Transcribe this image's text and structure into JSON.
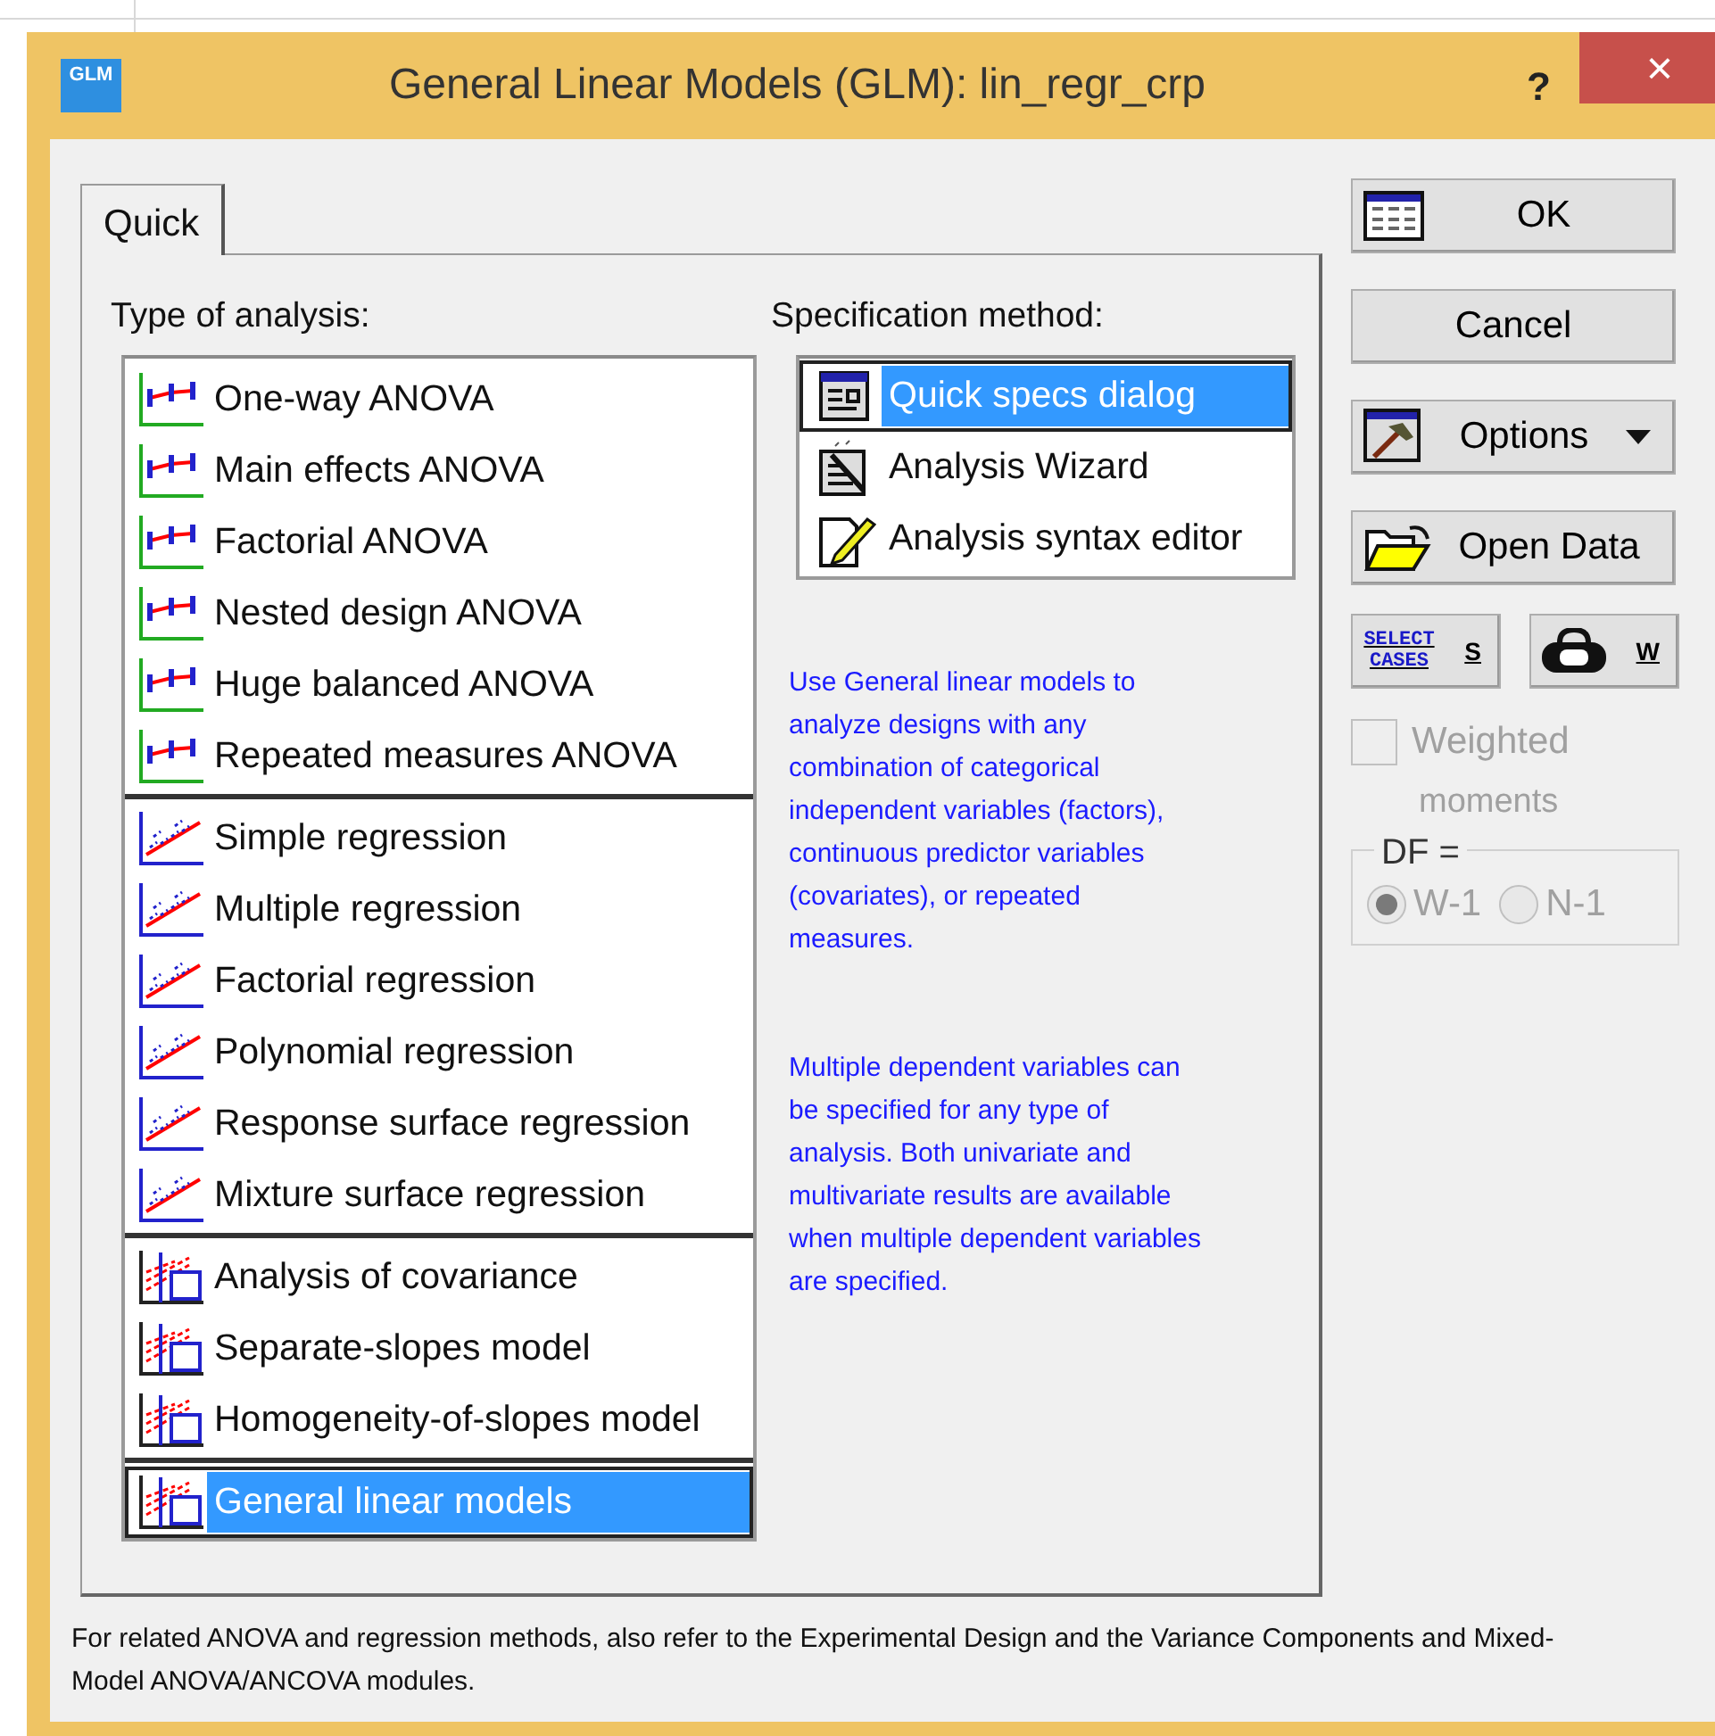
{
  "window": {
    "title": "General Linear Models (GLM): lin_regr_crp",
    "icon_text": "GLM",
    "help": "?",
    "close": "×"
  },
  "tabs": [
    {
      "label": "Quick",
      "selected": true
    }
  ],
  "analysis": {
    "label": "Type of analysis:",
    "groups": [
      {
        "items": [
          {
            "label": "One-way ANOVA",
            "selected": false
          },
          {
            "label": "Main effects ANOVA",
            "selected": false
          },
          {
            "label": "Factorial ANOVA",
            "selected": false
          },
          {
            "label": "Nested design ANOVA",
            "selected": false
          },
          {
            "label": "Huge balanced ANOVA",
            "selected": false
          },
          {
            "label": "Repeated measures ANOVA",
            "selected": false
          }
        ]
      },
      {
        "items": [
          {
            "label": "Simple regression",
            "selected": false
          },
          {
            "label": "Multiple regression",
            "selected": false
          },
          {
            "label": "Factorial regression",
            "selected": false
          },
          {
            "label": "Polynomial regression",
            "selected": false
          },
          {
            "label": "Response surface regression",
            "selected": false
          },
          {
            "label": "Mixture surface regression",
            "selected": false
          }
        ]
      },
      {
        "items": [
          {
            "label": "Analysis of covariance",
            "selected": false
          },
          {
            "label": "Separate-slopes model",
            "selected": false
          },
          {
            "label": "Homogeneity-of-slopes model",
            "selected": false
          }
        ]
      },
      {
        "items": [
          {
            "label": "General linear models",
            "selected": true
          }
        ]
      }
    ]
  },
  "specification": {
    "label": "Specification method:",
    "items": [
      {
        "label": "Quick specs dialog",
        "selected": true
      },
      {
        "label": "Analysis Wizard",
        "selected": false
      },
      {
        "label": "Analysis syntax editor",
        "selected": false
      }
    ]
  },
  "notes": [
    "Use General linear models to analyze designs with any combination of categorical independent variables (factors), continuous predictor variables (covariates), or repeated measures.",
    "Multiple dependent variables can be specified for any type of analysis.  Both univariate and multivariate results are available when multiple dependent variables are specified."
  ],
  "buttons": [
    {
      "label": "OK",
      "kind": "ok"
    },
    {
      "label": "Cancel",
      "kind": "plain"
    },
    {
      "label": "Options",
      "kind": "menu"
    },
    {
      "label": "Open Data",
      "kind": "open"
    }
  ],
  "tools": [
    {
      "kind": "select",
      "icon_text": "SELECT CASES",
      "label": "S"
    },
    {
      "kind": "weight",
      "label": "W"
    }
  ],
  "weighted": {
    "label": "Weighted",
    "sublabel": "moments",
    "checked": false,
    "disabled": true
  },
  "df": {
    "legend": "DF =",
    "disabled": true,
    "options": [
      {
        "label": "W-1",
        "selected": true
      },
      {
        "label": "N-1",
        "selected": false
      }
    ]
  },
  "footer": "For related ANOVA and regression methods, also refer to the Experimental Design and the Variance Components and Mixed-Model ANOVA/ANCOVA modules."
}
